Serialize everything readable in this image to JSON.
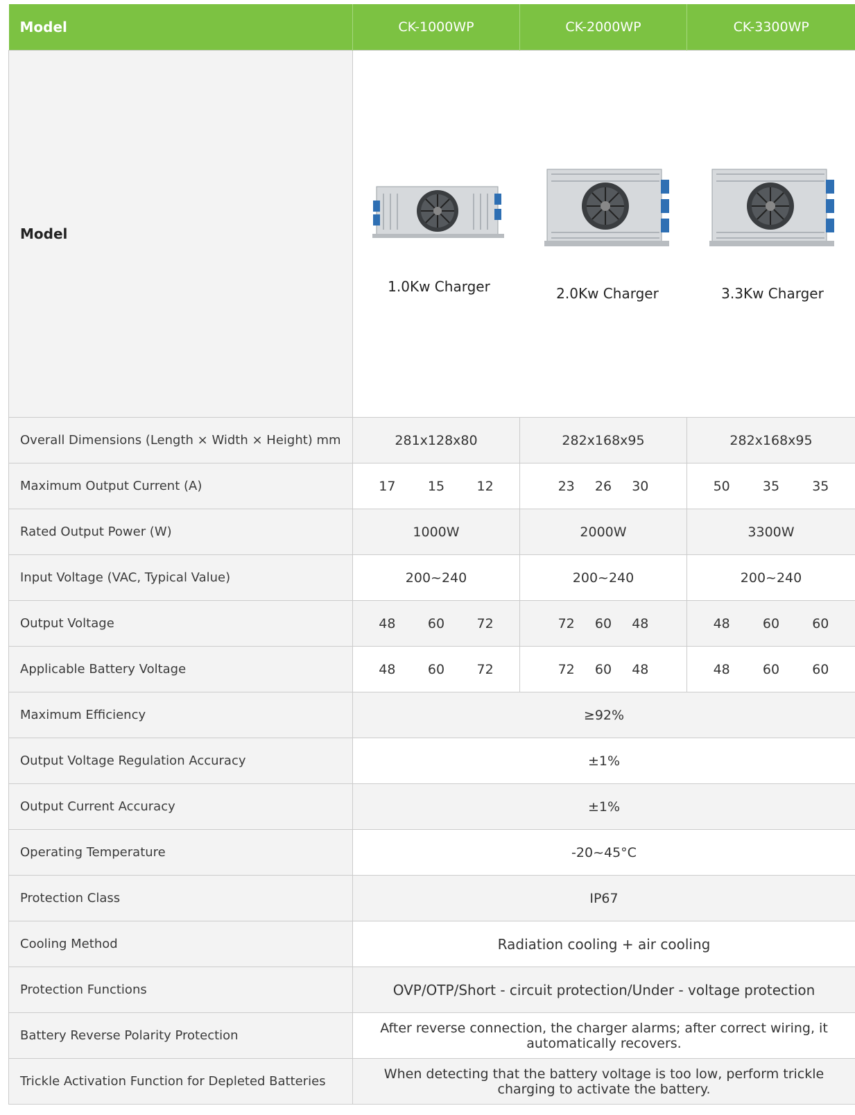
{
  "header": {
    "label": "Model",
    "models": [
      "CK-1000WP",
      "CK-2000WP",
      "CK-3300WP"
    ]
  },
  "image_row": {
    "label": "Model",
    "products": [
      {
        "caption": "1.0Kw Charger",
        "icon": "charger-1kw-image"
      },
      {
        "caption": "2.0Kw Charger",
        "icon": "charger-2kw-image"
      },
      {
        "caption": "3.3Kw Charger",
        "icon": "charger-3kw-image"
      }
    ]
  },
  "rows": {
    "dimensions": {
      "label": "Overall Dimensions (Length × Width × Height) mm",
      "values": [
        "281x128x80",
        "282x168x95",
        "282x168x95"
      ]
    },
    "max_current": {
      "label": "Maximum Output Current (A)",
      "values": [
        [
          "17",
          "15",
          "12"
        ],
        [
          "23",
          "26",
          "30"
        ],
        [
          "50",
          "35",
          "35"
        ]
      ]
    },
    "rated_power": {
      "label": "Rated Output Power (W)",
      "values": [
        "1000W",
        "2000W",
        "3300W"
      ]
    },
    "input_voltage": {
      "label": "Input Voltage (VAC, Typical Value)",
      "values": [
        "200~240",
        "200~240",
        "200~240"
      ]
    },
    "output_voltage": {
      "label": "Output Voltage",
      "values": [
        [
          "48",
          "60",
          "72"
        ],
        [
          "72",
          "60",
          "48"
        ],
        [
          "48",
          "60",
          "60"
        ]
      ]
    },
    "battery_voltage": {
      "label": "Applicable Battery Voltage",
      "values": [
        [
          "48",
          "60",
          "72"
        ],
        [
          "72",
          "60",
          "48"
        ],
        [
          "48",
          "60",
          "60"
        ]
      ]
    },
    "max_efficiency": {
      "label": "Maximum Efficiency",
      "value": "≥92%"
    },
    "voltage_accuracy": {
      "label": "Output Voltage Regulation Accuracy",
      "value": "±1%"
    },
    "current_accuracy": {
      "label": "Output Current Accuracy",
      "value": "±1%"
    },
    "operating_temp": {
      "label": "Operating Temperature",
      "value": "-20~45°C"
    },
    "protection_class": {
      "label": "Protection Class",
      "value": "IP67"
    },
    "cooling": {
      "label": "Cooling Method",
      "value": "Radiation cooling + air cooling"
    },
    "protection_functions": {
      "label": "Protection Functions",
      "value": "OVP/OTP/Short - circuit protection/Under - voltage protection"
    },
    "reverse_polarity": {
      "label": "Battery Reverse Polarity Protection",
      "value": "After reverse connection, the charger alarms; after correct wiring, it automatically recovers."
    },
    "trickle": {
      "label": "Trickle Activation Function for Depleted Batteries",
      "value": "When detecting that the battery voltage is too low, perform trickle charging to activate the battery."
    }
  },
  "colors": {
    "header_green": "#7cc242",
    "row_gray": "#f3f3f3"
  }
}
